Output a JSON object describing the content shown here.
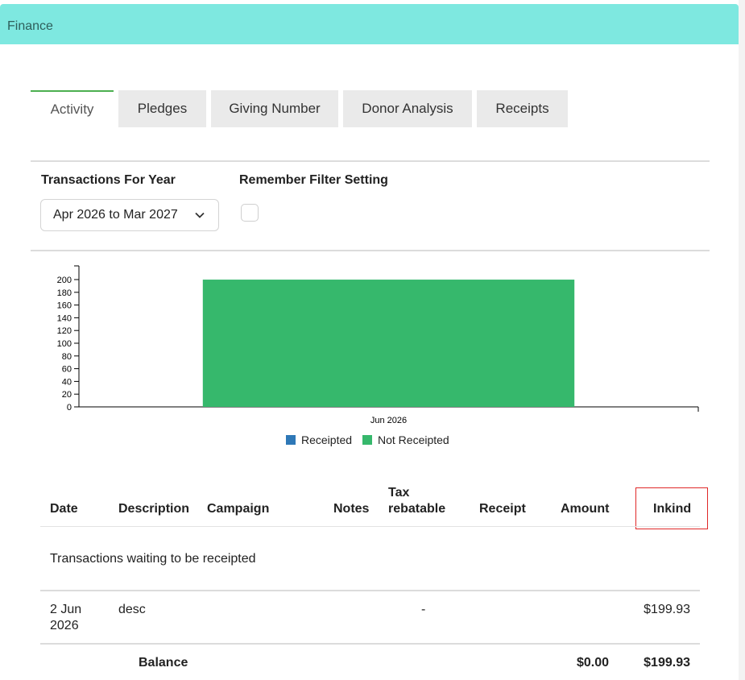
{
  "panel": {
    "title": "Finance"
  },
  "tabs": [
    {
      "label": "Activity",
      "active": true
    },
    {
      "label": "Pledges",
      "active": false
    },
    {
      "label": "Giving Number",
      "active": false
    },
    {
      "label": "Donor Analysis",
      "active": false
    },
    {
      "label": "Receipts",
      "active": false
    }
  ],
  "filters": {
    "year_label": "Transactions For Year",
    "year_value": "Apr 2026 to Mar 2027",
    "remember_label": "Remember Filter Setting",
    "remember_checked": false
  },
  "chart_data": {
    "type": "bar",
    "categories": [
      "Jun 2026"
    ],
    "series": [
      {
        "name": "Receipted",
        "values": [
          0
        ],
        "color": "#2e78b7"
      },
      {
        "name": "Not Receipted",
        "values": [
          199.93
        ],
        "color": "#36b86c"
      }
    ],
    "ylim": [
      0,
      200
    ],
    "yticks": [
      "0",
      "20",
      "40",
      "60",
      "80",
      "100",
      "120",
      "140",
      "160",
      "180",
      "200"
    ],
    "legend_position": "bottom-center",
    "grid": false
  },
  "table": {
    "headers": {
      "date": "Date",
      "description": "Description",
      "campaign": "Campaign",
      "notes": "Notes",
      "tax_line1": "Tax",
      "tax_line2": "rebatable",
      "receipt": "Receipt",
      "amount": "Amount",
      "inkind": "Inkind"
    },
    "group_label": "Transactions waiting to be receipted",
    "rows": [
      {
        "date_line1": "2 Jun",
        "date_line2": "2026",
        "description": "desc",
        "campaign": "",
        "notes": "",
        "tax_rebatable": "-",
        "receipt": "",
        "amount": "",
        "inkind": "$199.93"
      }
    ],
    "footer": {
      "label": "Balance",
      "amount": "$0.00",
      "inkind": "$199.93"
    }
  },
  "colors": {
    "header_bg": "#7ee8e0",
    "active_tab_accent": "#4caf50",
    "highlight": "#e02828"
  }
}
